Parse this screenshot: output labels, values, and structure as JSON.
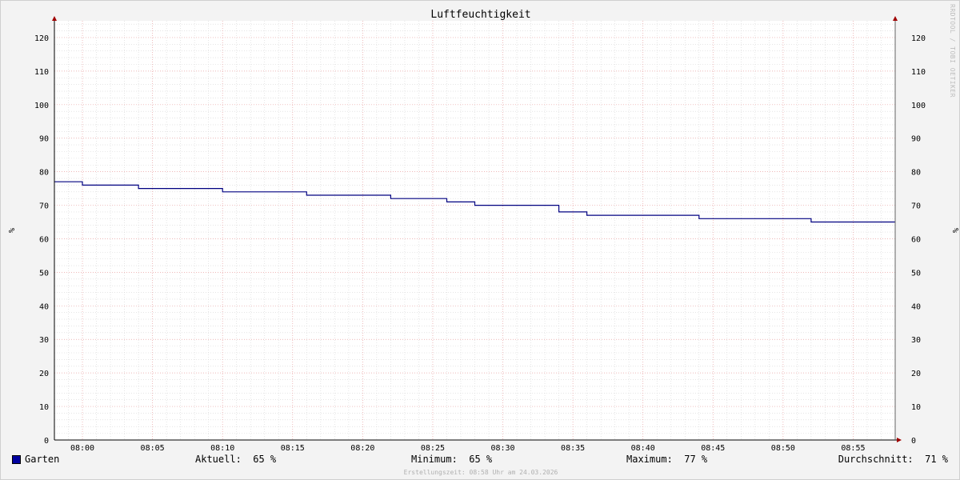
{
  "chart_data": {
    "type": "line",
    "line_style": "step",
    "title": "Luftfeuchtigkeit",
    "ylabel": "%",
    "ylim": [
      0,
      125
    ],
    "yticks": [
      0,
      10,
      20,
      30,
      40,
      50,
      60,
      70,
      80,
      90,
      100,
      110,
      120
    ],
    "xlim": [
      "07:58",
      "08:58"
    ],
    "xticks": [
      "08:00",
      "08:05",
      "08:10",
      "08:15",
      "08:20",
      "08:25",
      "08:30",
      "08:35",
      "08:40",
      "08:45",
      "08:50",
      "08:55"
    ],
    "grid": true,
    "series": [
      {
        "name": "Garten",
        "color": "#000080",
        "x": [
          "07:58",
          "08:00",
          "08:04",
          "08:10",
          "08:16",
          "08:22",
          "08:26",
          "08:28",
          "08:34",
          "08:36",
          "08:44",
          "08:52",
          "08:58"
        ],
        "values": [
          77,
          76,
          75,
          74,
          73,
          72,
          71,
          70,
          68,
          67,
          66,
          65,
          65
        ]
      }
    ]
  },
  "legend": {
    "series_name": "Garten",
    "swatch_color": "#0000a0",
    "aktuell": "Aktuell:  65 %",
    "minimum": "Minimum:  65 %",
    "maximum": "Maximum:  77 %",
    "durchschnitt": "Durchschnitt:  71 %"
  },
  "watermark": "RRDTOOL / TOBI OETIKER",
  "footer": "Erstellungszeit: 08:58 Uhr am 24.03.2026"
}
